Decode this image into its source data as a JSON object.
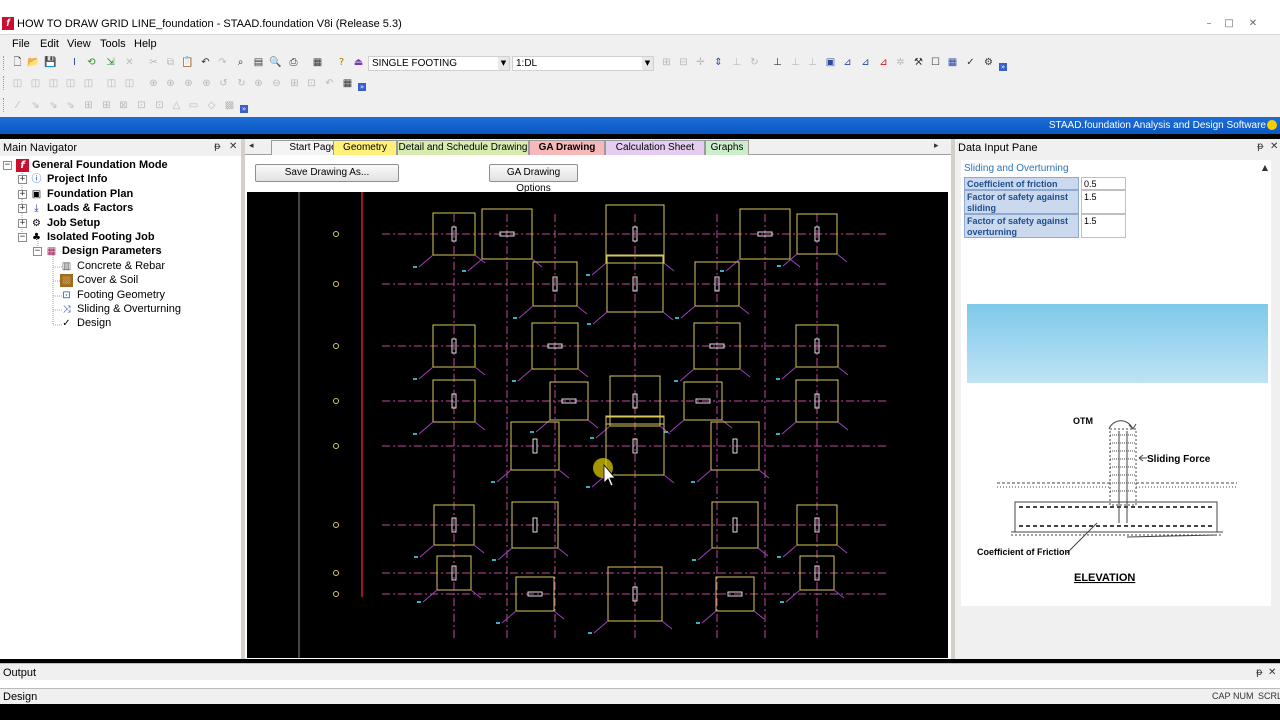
{
  "window": {
    "title": "HOW TO DRAW GRID LINE_foundation - STAAD.foundation V8i (Release 5.3)",
    "app_icon": "staad-icon"
  },
  "menu": [
    "File",
    "Edit",
    "View",
    "Tools",
    "Help"
  ],
  "toolbar": {
    "footing_type": "SINGLE FOOTING",
    "load_case": "1:DL"
  },
  "brand_bar": {
    "text": "STAAD.foundation Analysis and Design Software"
  },
  "navigator": {
    "title": "Main Navigator",
    "items": [
      {
        "label": "General Foundation Mode",
        "icon": "staad-icon",
        "bold": true
      },
      {
        "label": "Project Info",
        "icon": "info-icon",
        "bold": true
      },
      {
        "label": "Foundation Plan",
        "icon": "plan-icon",
        "bold": true
      },
      {
        "label": "Loads & Factors",
        "icon": "load-arrow-icon",
        "bold": true
      },
      {
        "label": "Job Setup",
        "icon": "job-setup-icon",
        "bold": true
      },
      {
        "label": "Isolated Footing Job",
        "icon": "footing-job-icon",
        "bold": true
      },
      {
        "label": "Design Parameters",
        "icon": "design-params-icon",
        "bold": true
      },
      {
        "label": "Concrete & Rebar",
        "icon": "rebar-icon",
        "bold": false
      },
      {
        "label": "Cover & Soil",
        "icon": "soil-icon",
        "bold": false
      },
      {
        "label": "Footing Geometry",
        "icon": "geometry-icon",
        "bold": false
      },
      {
        "label": "Sliding & Overturning",
        "icon": "sliding-icon",
        "bold": false
      },
      {
        "label": "Design",
        "icon": "checkmark-icon",
        "bold": false
      }
    ]
  },
  "tabs": [
    {
      "label": "Start Page",
      "color": "#f4f4f4"
    },
    {
      "label": "Geometry",
      "color": "#fff07a"
    },
    {
      "label": "Detail and Schedule Drawing",
      "color": "#d8ecb0"
    },
    {
      "label": "GA Drawing",
      "color": "#f6b8b8",
      "active": true
    },
    {
      "label": "Calculation Sheet",
      "color": "#e4cdf0"
    },
    {
      "label": "Graphs",
      "color": "#cdeecb"
    }
  ],
  "drawing": {
    "save_button": "Save Drawing As...",
    "options_button": "GA Drawing Options"
  },
  "data_input": {
    "title": "Data Input Pane",
    "section": "Sliding and Overturning",
    "params": [
      {
        "label": "Coefficient of friction",
        "value": "0.5"
      },
      {
        "label": "Factor of safety against sliding",
        "value": "1.5"
      },
      {
        "label": "Factor of safety against overturning",
        "value": "1.5"
      }
    ],
    "diagram": {
      "otm": "OTM",
      "sliding_force": "Sliding Force",
      "coef_friction": "Coefficient of Friction",
      "elevation": "ELEVATION"
    }
  },
  "output": {
    "title": "Output"
  },
  "status": {
    "left": "Design",
    "caps": "CAP",
    "num": "NUM",
    "scrl": "SCRL"
  },
  "colors": {
    "footing": "#d6c95a",
    "grid": "#c04ca0",
    "column": "#e0e0e0",
    "cursor_halo": "#d9c800"
  }
}
